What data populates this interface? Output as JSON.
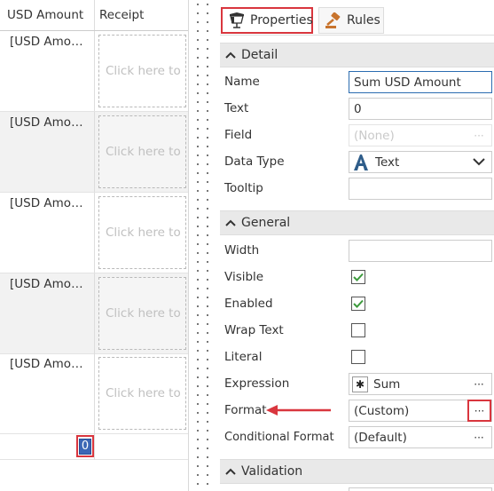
{
  "grid": {
    "columns": [
      "USD Amount",
      "Receipt"
    ],
    "rows": [
      {
        "amount": "[USD Amount]",
        "receipt": "Click here to upload",
        "alt": false
      },
      {
        "amount": "[USD Amount]",
        "receipt": "Click here to upload",
        "alt": true
      },
      {
        "amount": "[USD Amount]",
        "receipt": "Click here to upload",
        "alt": false
      },
      {
        "amount": "[USD Amount]",
        "receipt": "Click here to upload",
        "alt": true
      },
      {
        "amount": "[USD Amount]",
        "receipt": "Click here to upload",
        "alt": false
      }
    ],
    "sum_value": "0"
  },
  "tabs": {
    "properties": "Properties",
    "rules": "Rules"
  },
  "sections": {
    "detail": "Detail",
    "general": "General",
    "validation": "Validation"
  },
  "detail": {
    "name_label": "Name",
    "name_value": "Sum USD Amount",
    "text_label": "Text",
    "text_value": "0",
    "field_label": "Field",
    "field_value": "(None)",
    "datatype_label": "Data Type",
    "datatype_value": "Text",
    "tooltip_label": "Tooltip",
    "tooltip_value": ""
  },
  "general": {
    "width_label": "Width",
    "width_value": "",
    "visible_label": "Visible",
    "visible_checked": true,
    "enabled_label": "Enabled",
    "enabled_checked": true,
    "wrap_label": "Wrap Text",
    "wrap_checked": false,
    "literal_label": "Literal",
    "literal_checked": false,
    "expression_label": "Expression",
    "expression_value": "Sum",
    "format_label": "Format",
    "format_value": "(Custom)",
    "condformat_label": "Conditional Format",
    "condformat_value": "(Default)"
  },
  "ellipsis": "···",
  "colors": {
    "highlight": "#d9363e",
    "selection": "#3b66b5",
    "check": "#3c9a3c",
    "datatype_icon": "#2f5d8a"
  }
}
